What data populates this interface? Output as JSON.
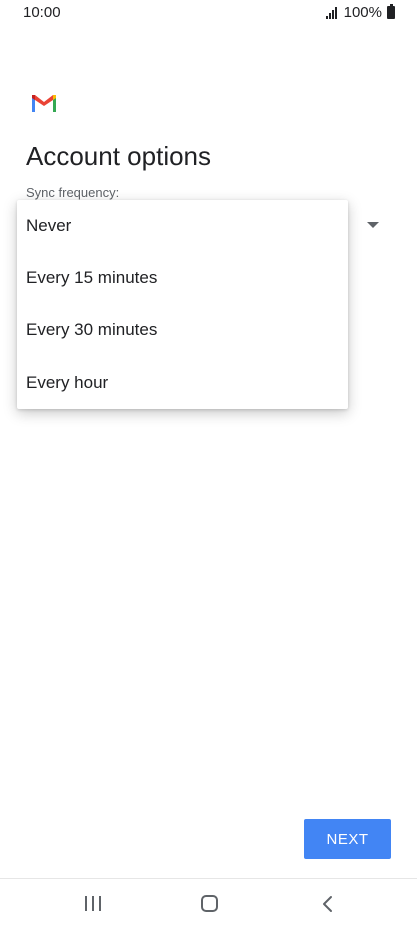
{
  "status_bar": {
    "time": "10:00",
    "battery": "100%"
  },
  "app": {
    "logo": "gmail-logo-icon"
  },
  "page": {
    "title": "Account options",
    "sync_label": "Sync frequency:"
  },
  "menu": {
    "items": [
      {
        "label": "Never"
      },
      {
        "label": "Every 15 minutes"
      },
      {
        "label": "Every 30 minutes"
      },
      {
        "label": "Every hour"
      }
    ]
  },
  "actions": {
    "next_label": "NEXT"
  },
  "colors": {
    "accent": "#4285f4",
    "gmail_red": "#ea4335",
    "gmail_blue": "#4285f4",
    "gmail_green": "#34a853",
    "gmail_yellow": "#fbbc04"
  }
}
